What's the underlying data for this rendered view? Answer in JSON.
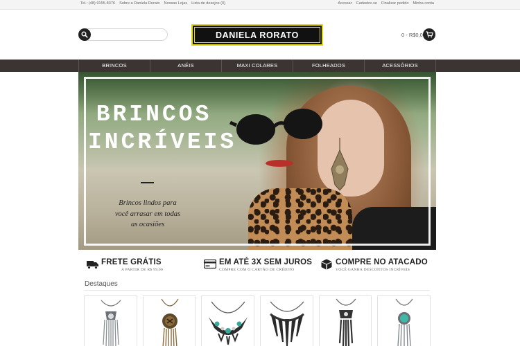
{
  "topbar": {
    "left_links": [
      "Tel.: (48) 9155-8376",
      "Sobre a Daniela Rorato",
      "Nossas Lojas",
      "Lista de desejos (0)"
    ],
    "right_links": [
      "Acessar",
      "Cadastre-se",
      "Finalizar pedido",
      "Minha conta"
    ]
  },
  "header": {
    "logo_text": "DANIELA RORATO",
    "search": {
      "placeholder": "",
      "value": ""
    },
    "cart_total": "0 - R$0,00"
  },
  "nav": {
    "items": [
      "BRINCOS",
      "ANÉIS",
      "MAXI COLARES",
      "FOLHEADOS",
      "ACESSÓRIOS"
    ]
  },
  "banner": {
    "headline_line1": "BRINCOS",
    "headline_line2": "INCRÍVEIS",
    "tagline": "Brincos lindos para você arrasar em todas as ocasiões"
  },
  "features": [
    {
      "icon": "truck-icon",
      "title": "FRETE GRÁTIS",
      "subtitle": "A PARTIR DE R$ 99,00"
    },
    {
      "icon": "credit-card-icon",
      "title": "EM ATÉ 3X SEM JUROS",
      "subtitle": "COMPRE COM O CARTÃO DE CRÉDITO"
    },
    {
      "icon": "box-icon",
      "title": "COMPRE NO ATACADO",
      "subtitle": "VOCÊ GANHA DESCONTOS INCRÍVEIS"
    }
  ],
  "section": {
    "title": "Destaques"
  },
  "products": [
    {
      "name": "silver-fringe-necklace",
      "accent": "#9aa0a6"
    },
    {
      "name": "bronze-medallion-necklace",
      "accent": "#8c6a3a"
    },
    {
      "name": "turquoise-bib-necklace",
      "accent": "#3aa89a"
    },
    {
      "name": "black-feather-necklace",
      "accent": "#2a2a2a"
    },
    {
      "name": "black-tassel-necklace",
      "accent": "#333333"
    },
    {
      "name": "turquoise-pendant-necklace",
      "accent": "#3fb8a8"
    }
  ],
  "colors": {
    "nav_bg": "#3b3433",
    "logo_border": "#e2d80a",
    "icon_dark": "#222222"
  }
}
